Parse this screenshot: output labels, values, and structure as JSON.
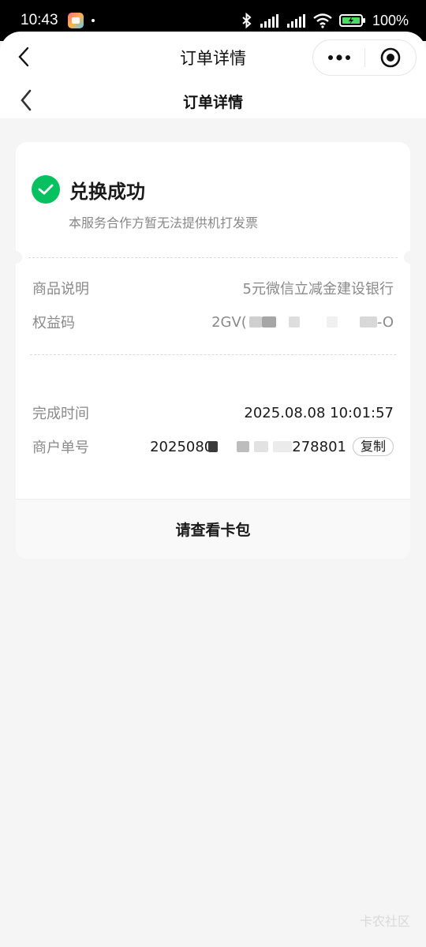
{
  "status_bar": {
    "time": "10:43",
    "battery": "100%"
  },
  "top_bar": {
    "title": "订单详情"
  },
  "page_nav": {
    "title": "订单详情"
  },
  "order": {
    "status_title": "兑换成功",
    "status_subtitle": "本服务合作方暂无法提供机打发票",
    "product_label": "商品说明",
    "product_value": "5元微信立减金建设银行",
    "code_label": "权益码",
    "code_value_prefix": "2GV(",
    "code_value_suffix": "-O",
    "complete_time_label": "完成时间",
    "complete_time_value": "2025.08.08 10:01:57",
    "merchant_no_label": "商户单号",
    "merchant_no_prefix": "2025080",
    "merchant_no_suffix": "278801",
    "copy_label": "复制"
  },
  "footer": {
    "link_label": "请查看卡包"
  },
  "watermark": "卡农社区",
  "colors": {
    "success": "#07c160",
    "background": "#f5f5f5"
  },
  "icons": {
    "back": "chevron-left-icon",
    "more": "more-dots-icon",
    "close": "target-close-icon",
    "success": "check-circle-icon"
  }
}
